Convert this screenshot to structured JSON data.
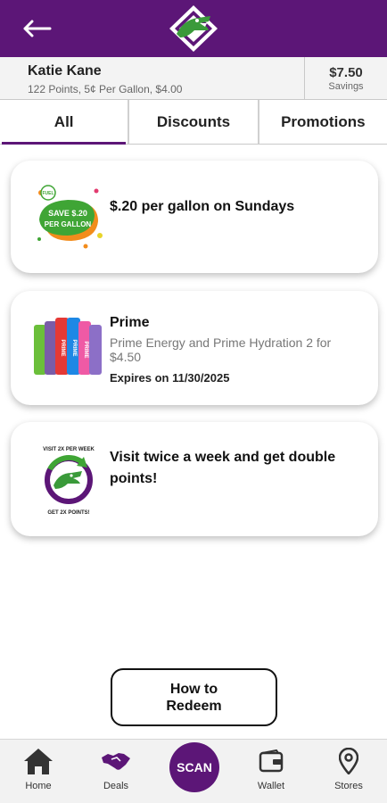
{
  "colors": {
    "brand": "#5c1677",
    "accent_green": "#3fa535",
    "accent_orange": "#f28c1c"
  },
  "header": {
    "back_icon": "arrow-left-icon",
    "logo_icon": "alligator-logo"
  },
  "user": {
    "name": "Katie Kane",
    "info": "122 Points, 5¢ Per Gallon, $4.00",
    "savings_amount": "$7.50",
    "savings_label": "Savings"
  },
  "tabs": [
    {
      "label": "All",
      "active": true
    },
    {
      "label": "Discounts",
      "active": false
    },
    {
      "label": "Promotions",
      "active": false
    }
  ],
  "deals": [
    {
      "title": "$.20 per gallon on Sundays",
      "image": {
        "icon": "fuel-discount-badge",
        "top_text": "FUEL",
        "big_text": "SAVE $.20",
        "sub_text": "PER GALLON"
      }
    },
    {
      "title": "Prime",
      "description": "Prime Energy and Prime Hydration 2 for $4.50",
      "expires": "Expires on 11/30/2025",
      "image": {
        "icon": "prime-bottles",
        "can_text": "PRIME"
      }
    },
    {
      "title": "Visit twice a week and get double points!",
      "image": {
        "icon": "double-points-badge",
        "top_text": "VISIT 2X PER WEEK",
        "bottom_text": "GET 2X POINTS!"
      }
    }
  ],
  "redeem_button": "How to Redeem",
  "nav": {
    "home": "Home",
    "deals": "Deals",
    "scan": "SCAN",
    "wallet": "Wallet",
    "stores": "Stores"
  }
}
